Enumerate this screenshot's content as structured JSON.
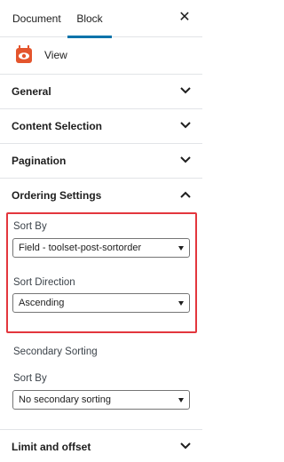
{
  "tabs": {
    "document": "Document",
    "block": "Block",
    "close_icon": "close-icon"
  },
  "block": {
    "title": "View",
    "icon": "eye-icon",
    "icon_color": "#e4552d"
  },
  "panels": {
    "general": "General",
    "content_selection": "Content Selection",
    "pagination": "Pagination",
    "ordering": "Ordering Settings",
    "limit": "Limit and offset"
  },
  "ordering": {
    "sort_by_label": "Sort By",
    "sort_by_value": "Field - toolset-post-sortorder",
    "sort_direction_label": "Sort Direction",
    "sort_direction_value": "Ascending",
    "highlight_color": "#e3363d"
  },
  "secondary": {
    "heading": "Secondary Sorting",
    "sort_by_label": "Sort By",
    "sort_by_value": "No secondary sorting"
  },
  "accent_color": "#0073aa"
}
